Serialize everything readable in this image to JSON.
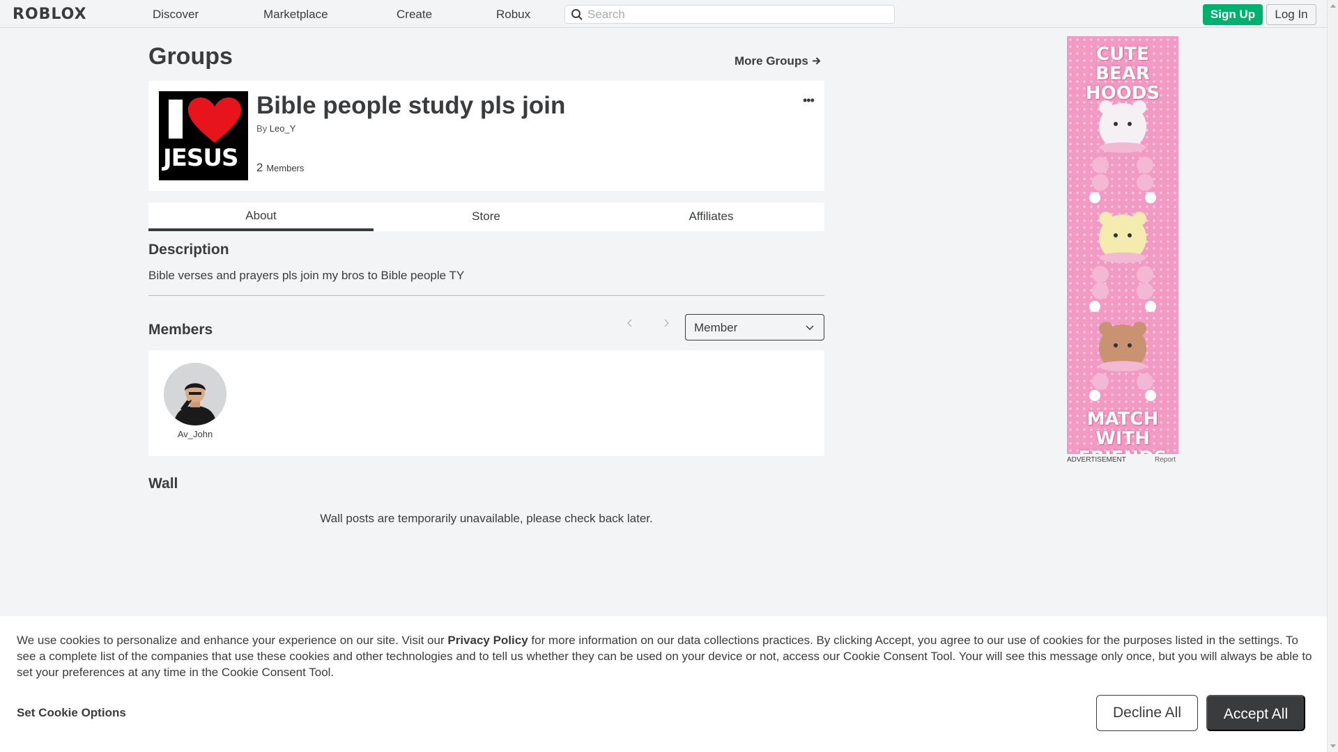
{
  "nav": {
    "logo": "ROBLOX",
    "links": [
      "Discover",
      "Marketplace",
      "Create",
      "Robux"
    ],
    "search_placeholder": "Search",
    "signup": "Sign Up",
    "login": "Log In"
  },
  "page": {
    "title": "Groups",
    "more_groups": "More Groups"
  },
  "group": {
    "emblem_text": "JESUS",
    "name": "Bible people study pls join",
    "by_label": "By",
    "owner": "Leo_Y",
    "member_count": "2",
    "member_label": "Members"
  },
  "tabs": [
    "About",
    "Store",
    "Affiliates"
  ],
  "about": {
    "description_heading": "Description",
    "description": "Bible verses and prayers pls join my bros to Bible people TY",
    "members_heading": "Members",
    "role_filter": "Member",
    "members": [
      {
        "name": "Av_John"
      }
    ],
    "wall_heading": "Wall",
    "wall_message": "Wall posts are temporarily unavailable, please check back later."
  },
  "ad": {
    "top_text": "CUTE BEAR HOODS",
    "bottom_text": "MATCH WITH FRIENDS",
    "label": "ADVERTISEMENT",
    "report": "Report"
  },
  "cookie": {
    "text_before": "We use cookies to personalize and enhance your experience on our site. Visit our ",
    "privacy_link": "Privacy Policy",
    "text_after": " for more information on our data collections practices. By clicking Accept, you agree to our use of cookies for the purposes listed in the settings. To see a complete list of the companies that use these cookies and other technologies and to tell us whether they can be used on your device or not, access our Cookie Consent Tool. Your will see this message only once, but you will always be able to set your preferences at any time in the Cookie Consent Tool.",
    "options": "Set Cookie Options",
    "decline": "Decline All",
    "accept": "Accept All"
  },
  "colors": {
    "accent_green": "#00b06f",
    "text_dark": "#393b3d",
    "background": "#f2f4f5",
    "ad_pink": "#f4a6c9"
  },
  "icons": [
    "search-icon",
    "arrow-right-icon",
    "more-options-icon",
    "chevron-left-icon",
    "chevron-right-icon",
    "chevron-down-icon"
  ]
}
